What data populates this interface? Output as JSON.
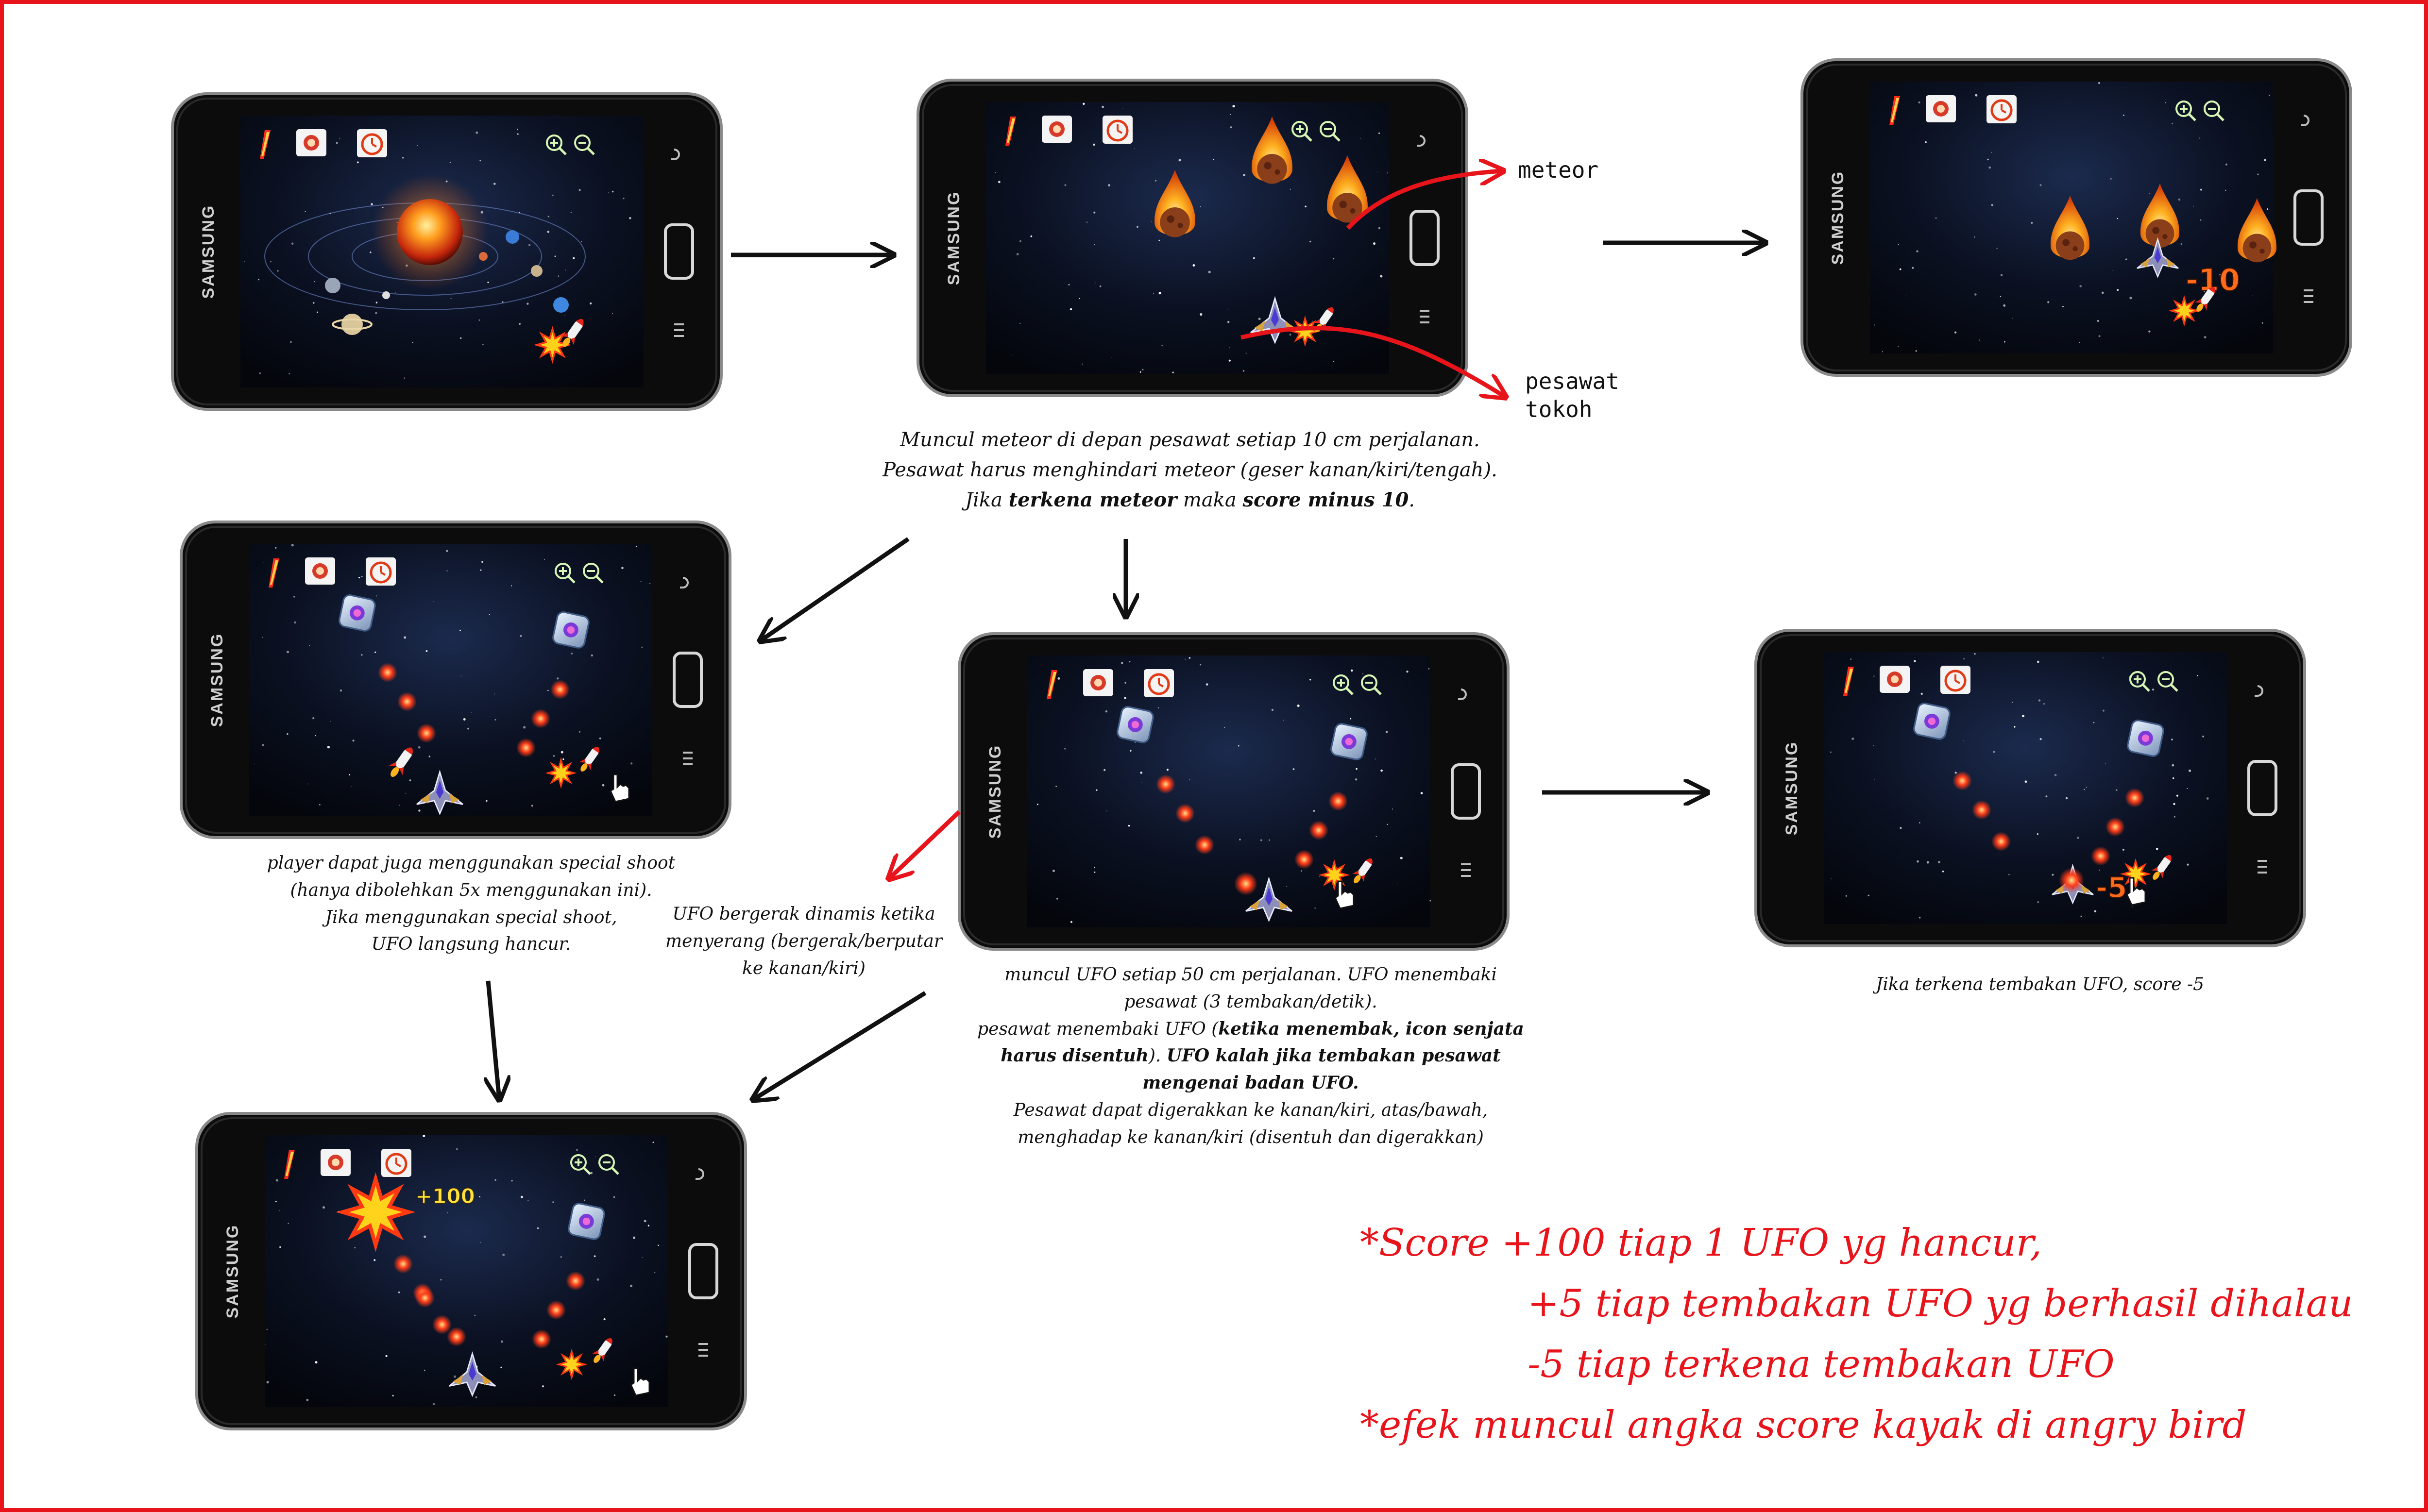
{
  "colors": {
    "frame": "#e8141b",
    "phone": "#111111",
    "space": "#0b0f1c",
    "arrow": "#111111",
    "annotation": "#e8141b"
  },
  "phone": {
    "brand": "SAMSUNG"
  },
  "hud_icons": [
    "weapon-icon",
    "shield-icon",
    "stopwatch-icon",
    "zoom-in-icon",
    "zoom-out-icon",
    "explosion-icon",
    "rocket-icon"
  ],
  "annotations": {
    "meteor": "meteor",
    "pesawat1": "pesawat",
    "pesawat2": "tokoh"
  },
  "screens": {
    "s3_score": "-10",
    "s6_score": "-5",
    "s7_score": "+100"
  },
  "notes": {
    "meteor": {
      "l1": "Muncul meteor di depan pesawat setiap 10 cm perjalanan.",
      "l2": "Pesawat harus menghindari meteor (geser kanan/kiri/tengah).",
      "l3a": "Jika ",
      "l3b": "terkena meteor",
      "l3c": " maka ",
      "l3d": "score minus 10",
      "l3e": "."
    },
    "special": {
      "l1": "player dapat juga menggunakan special shoot",
      "l2": "(hanya dibolehkan 5x menggunakan ini).",
      "l3": "Jika menggunakan special shoot,",
      "l4": "UFO langsung hancur."
    },
    "ufo_move": {
      "l1": "UFO bergerak dinamis ketika",
      "l2": "menyerang (bergerak/berputar",
      "l3": "ke kanan/kiri)"
    },
    "ufo": {
      "l1": "muncul UFO setiap 50 cm perjalanan. UFO menembaki",
      "l2": "pesawat (3 tembakan/detik).",
      "l3a": "pesawat menembaki UFO (",
      "l3b": "ketika menembak, icon senjata",
      "l4a": "harus disentuh",
      "l4b": "). ",
      "l4c": "UFO kalah jika tembakan pesawat",
      "l5": "mengenai badan UFO.",
      "l6": "Pesawat dapat digerakkan ke kanan/kiri, atas/bawah,",
      "l7": "menghadap ke kanan/kiri (disentuh dan digerakkan)"
    },
    "hit": "Jika terkena tembakan UFO, score -5"
  },
  "rules": {
    "l1": "*Score +100 tiap 1 UFO yg hancur,",
    "l2": "+5 tiap tembakan UFO yg berhasil dihalau",
    "l3": "-5 tiap terkena tembakan UFO",
    "l4": "*efek muncul angka score kayak di angry bird"
  }
}
